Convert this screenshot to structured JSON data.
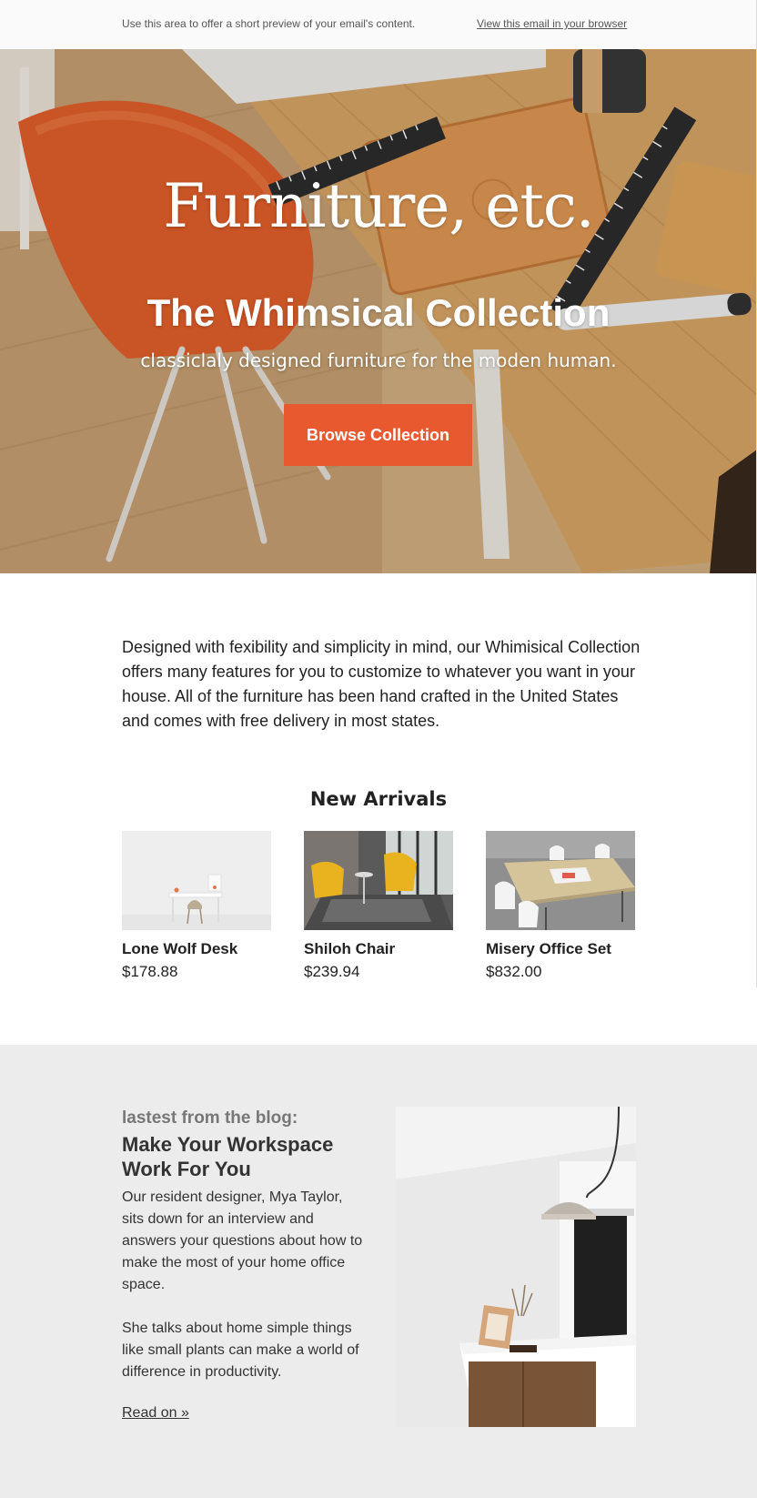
{
  "preheader": {
    "preview_text": "Use this area to offer a short preview of your email's content.",
    "browser_link": "View this email in your browser"
  },
  "hero": {
    "title": "Furniture, etc.",
    "subtitle": "The Whimsical Collection",
    "tagline": "classiclaly designed furniture for the moden human.",
    "cta_label": "Browse Collection"
  },
  "intro": {
    "text": "Designed with fexibility and simplicity in mind, our Whimisical Collection offers many features for you to customize to whatever you want in your house. All of the furniture has been hand crafted in the United States and comes with free delivery in most states."
  },
  "arrivals": {
    "heading": "New Arrivals",
    "products": [
      {
        "name": "Lone Wolf Desk",
        "price": "$178.88"
      },
      {
        "name": "Shiloh Chair",
        "price": "$239.94"
      },
      {
        "name": "Misery Office Set",
        "price": "$832.00"
      }
    ]
  },
  "blog": {
    "kicker": "lastest from the blog:",
    "headline": "Make Your Workspace Work For You",
    "paragraph1": "Our resident designer, Mya Taylor, sits down for an interview and answers your questions about how to make the most of your home office space.",
    "paragraph2": "She talks about home simple things like small plants can make a world of difference in productivity.",
    "read_on": "Read on »"
  },
  "colors": {
    "accent": "#e8592f",
    "preheader_bg": "#fafafa",
    "blog_bg": "#ececec",
    "text": "#222222"
  }
}
